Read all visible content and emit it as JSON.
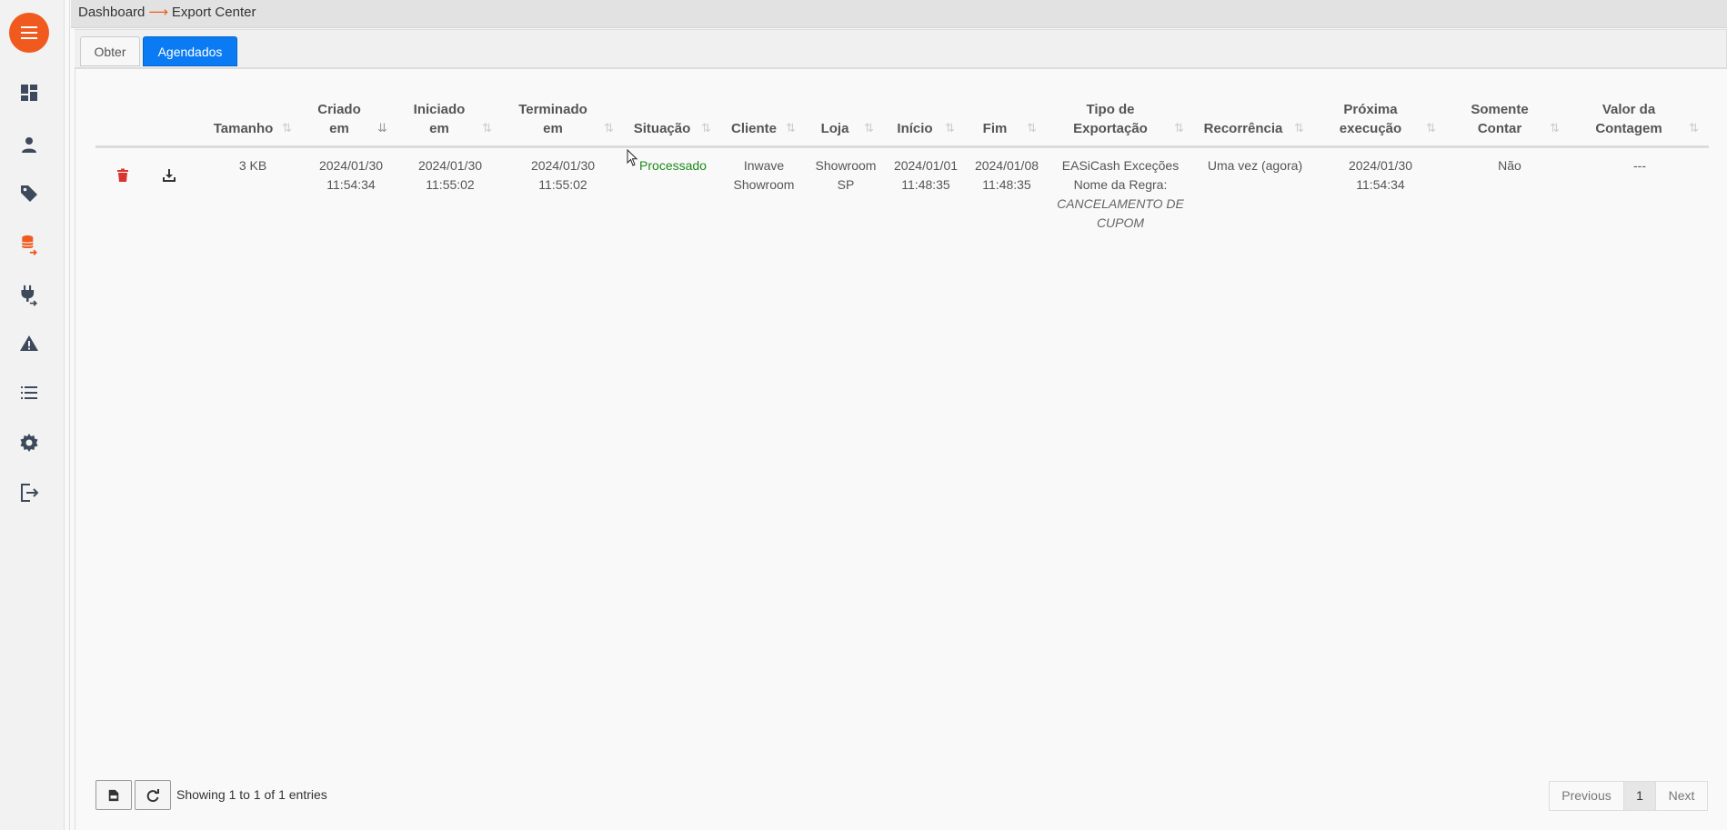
{
  "breadcrumb": {
    "root": "Dashboard",
    "arrow": "⟶",
    "current": "Export Center"
  },
  "tabs": [
    {
      "label": "Obter",
      "active": false
    },
    {
      "label": "Agendados",
      "active": true
    }
  ],
  "sidebar": {
    "items": [
      {
        "icon": "menu-icon"
      },
      {
        "icon": "dashboard-icon"
      },
      {
        "icon": "user-icon"
      },
      {
        "icon": "tag-icon"
      },
      {
        "icon": "database-export-icon"
      },
      {
        "icon": "plug-icon"
      },
      {
        "icon": "warning-icon"
      },
      {
        "icon": "list-icon"
      },
      {
        "icon": "gear-icon"
      },
      {
        "icon": "logout-icon"
      }
    ],
    "accent_color": "#f05a1e"
  },
  "table": {
    "headers": {
      "tamanho": "Tamanho",
      "criado_1": "Criado",
      "criado_2": "em",
      "iniciado_1": "Iniciado",
      "iniciado_2": "em",
      "terminado_1": "Terminado",
      "terminado_2": "em",
      "situacao": "Situação",
      "cliente": "Cliente",
      "loja": "Loja",
      "inicio": "Início",
      "fim": "Fim",
      "tipo_1": "Tipo de",
      "tipo_2": "Exportação",
      "recorrencia": "Recorrência",
      "proxima_1": "Próxima",
      "proxima_2": "execução",
      "somente_1": "Somente",
      "somente_2": "Contar",
      "valor_1": "Valor da",
      "valor_2": "Contagem"
    },
    "rows": [
      {
        "tamanho": "3 KB",
        "criado_date": "2024/01/30",
        "criado_time": "11:54:34",
        "iniciado_date": "2024/01/30",
        "iniciado_time": "11:55:02",
        "terminado_date": "2024/01/30",
        "terminado_time": "11:55:02",
        "situacao": "Processado",
        "cliente_1": "Inwave",
        "cliente_2": "Showroom",
        "loja_1": "Showroom",
        "loja_2": "SP",
        "inicio_date": "2024/01/01",
        "inicio_time": "11:48:35",
        "fim_date": "2024/01/08",
        "fim_time": "11:48:35",
        "tipo_1": "EASiCash Exceções",
        "tipo_2": "Nome da Regra:",
        "tipo_3": "CANCELAMENTO DE",
        "tipo_4": "CUPOM",
        "recorrencia": "Uma vez (agora)",
        "proxima_date": "2024/01/30",
        "proxima_time": "11:54:34",
        "somente": "Não",
        "valor": "---"
      }
    ]
  },
  "footer": {
    "info": "Showing 1 to 1 of 1 entries",
    "previous": "Previous",
    "page": "1",
    "next": "Next"
  }
}
